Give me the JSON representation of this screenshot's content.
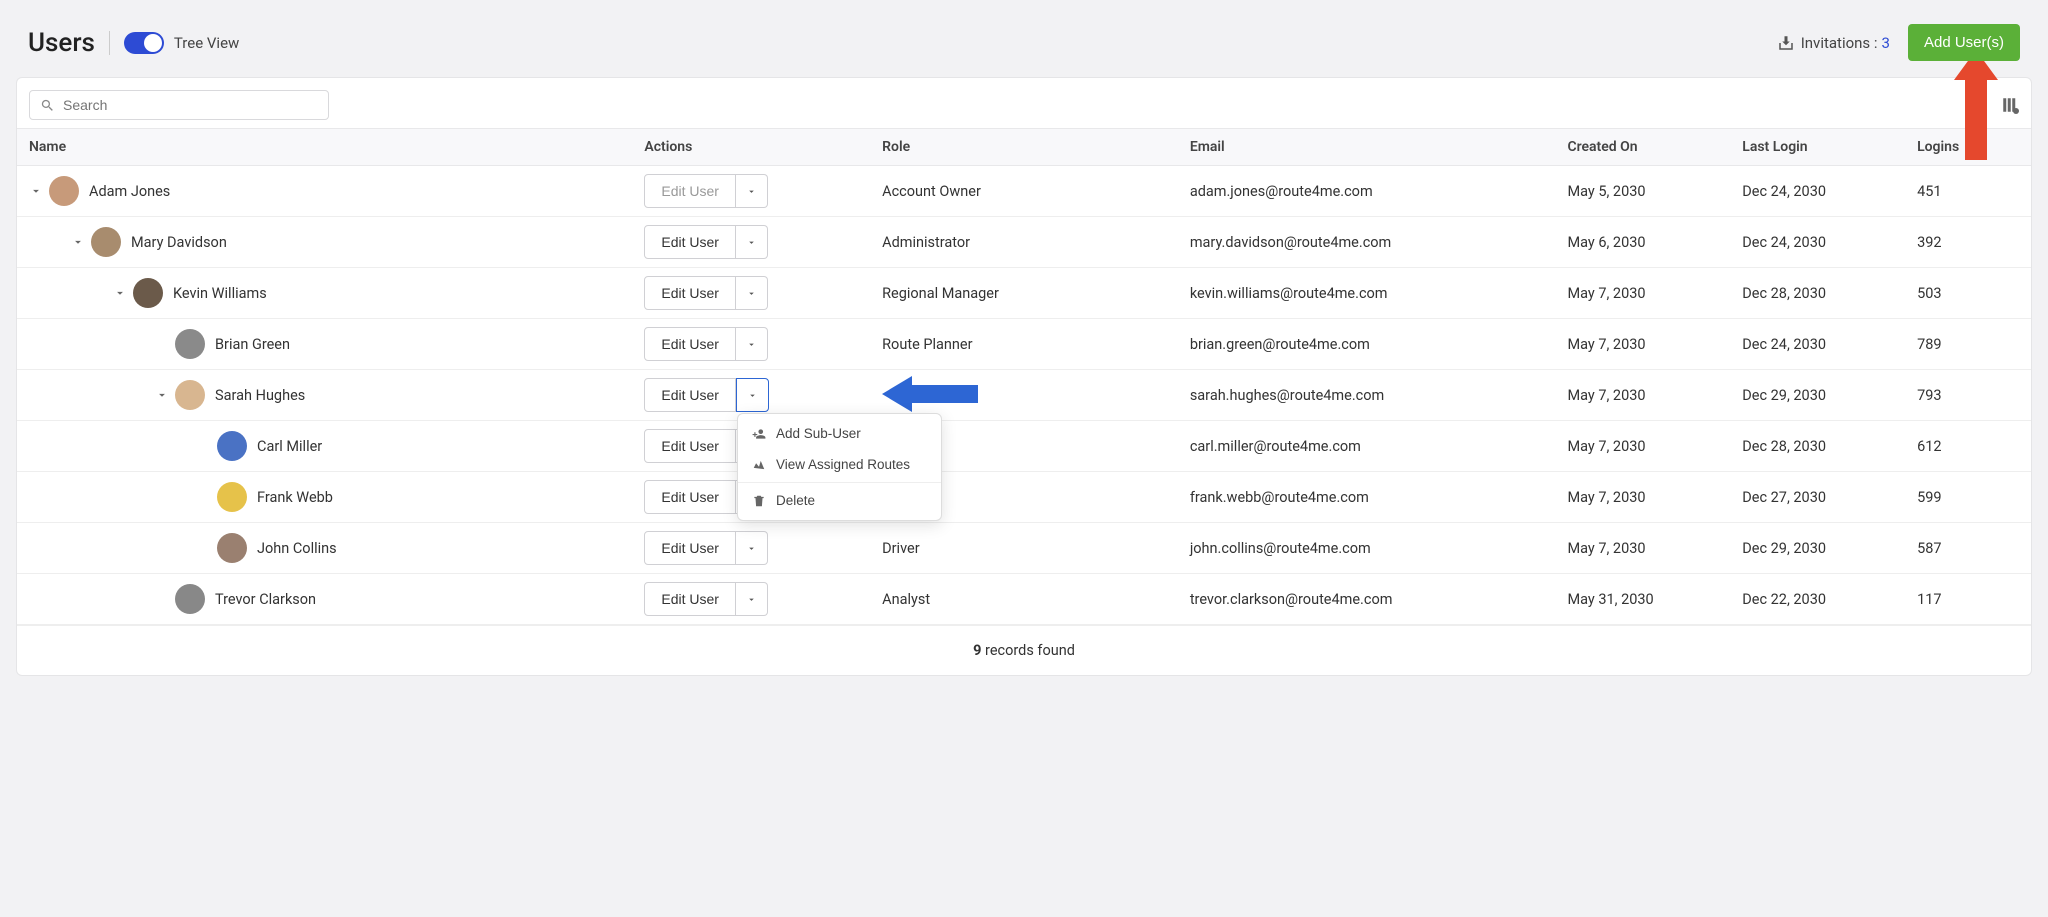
{
  "page": {
    "title": "Users",
    "toggleLabel": "Tree View"
  },
  "invitations": {
    "label": "Invitations :",
    "count": "3"
  },
  "addUser": {
    "label": "Add User(s)"
  },
  "search": {
    "placeholder": "Search"
  },
  "columns": {
    "name": "Name",
    "actions": "Actions",
    "role": "Role",
    "email": "Email",
    "created": "Created On",
    "lastLogin": "Last Login",
    "logins": "Logins"
  },
  "editLabel": "Edit User",
  "menu": {
    "addSub": "Add Sub-User",
    "viewRoutes": "View Assigned Routes",
    "delete": "Delete"
  },
  "rows": [
    {
      "indent": 0,
      "hasExpand": true,
      "name": "Adam Jones",
      "role": "Account Owner",
      "email": "adam.jones@route4me.com",
      "created": "May 5, 2030",
      "lastLogin": "Dec 24, 2030",
      "logins": "451",
      "editDisabled": true,
      "avatarBg": "#c79a7a"
    },
    {
      "indent": 1,
      "hasExpand": true,
      "name": "Mary Davidson",
      "role": "Administrator",
      "email": "mary.davidson@route4me.com",
      "created": "May 6, 2030",
      "lastLogin": "Dec 24, 2030",
      "logins": "392",
      "avatarBg": "#a88c6e"
    },
    {
      "indent": 2,
      "hasExpand": true,
      "name": "Kevin Williams",
      "role": "Regional Manager",
      "email": "kevin.williams@route4me.com",
      "created": "May 7, 2030",
      "lastLogin": "Dec 28, 2030",
      "logins": "503",
      "avatarBg": "#6b5a4a"
    },
    {
      "indent": 3,
      "hasExpand": false,
      "name": "Brian Green",
      "role": "Route Planner",
      "email": "brian.green@route4me.com",
      "created": "May 7, 2030",
      "lastLogin": "Dec 24, 2030",
      "logins": "789",
      "avatarBg": "#8a8a8a"
    },
    {
      "indent": 3,
      "hasExpand": true,
      "name": "Sarah Hughes",
      "role": "",
      "email": "sarah.hughes@route4me.com",
      "created": "May 7, 2030",
      "lastLogin": "Dec 29, 2030",
      "logins": "793",
      "dropdownOpen": true,
      "avatarBg": "#d8b690"
    },
    {
      "indent": 4,
      "hasExpand": false,
      "name": "Carl Miller",
      "role": "",
      "email": "carl.miller@route4me.com",
      "created": "May 7, 2030",
      "lastLogin": "Dec 28, 2030",
      "logins": "612",
      "avatarBg": "#4a72c4"
    },
    {
      "indent": 4,
      "hasExpand": false,
      "name": "Frank Webb",
      "role": "",
      "email": "frank.webb@route4me.com",
      "created": "May 7, 2030",
      "lastLogin": "Dec 27, 2030",
      "logins": "599",
      "avatarBg": "#e6c24a"
    },
    {
      "indent": 4,
      "hasExpand": false,
      "name": "John Collins",
      "role": "Driver",
      "email": "john.collins@route4me.com",
      "created": "May 7, 2030",
      "lastLogin": "Dec 29, 2030",
      "logins": "587",
      "avatarBg": "#9a8070"
    },
    {
      "indent": 3,
      "hasExpand": false,
      "name": "Trevor Clarkson",
      "role": "Analyst",
      "email": "trevor.clarkson@route4me.com",
      "created": "May 31, 2030",
      "lastLogin": "Dec 22, 2030",
      "logins": "117",
      "avatarBg": "#888"
    }
  ],
  "footer": {
    "count": "9",
    "label": " records found"
  }
}
